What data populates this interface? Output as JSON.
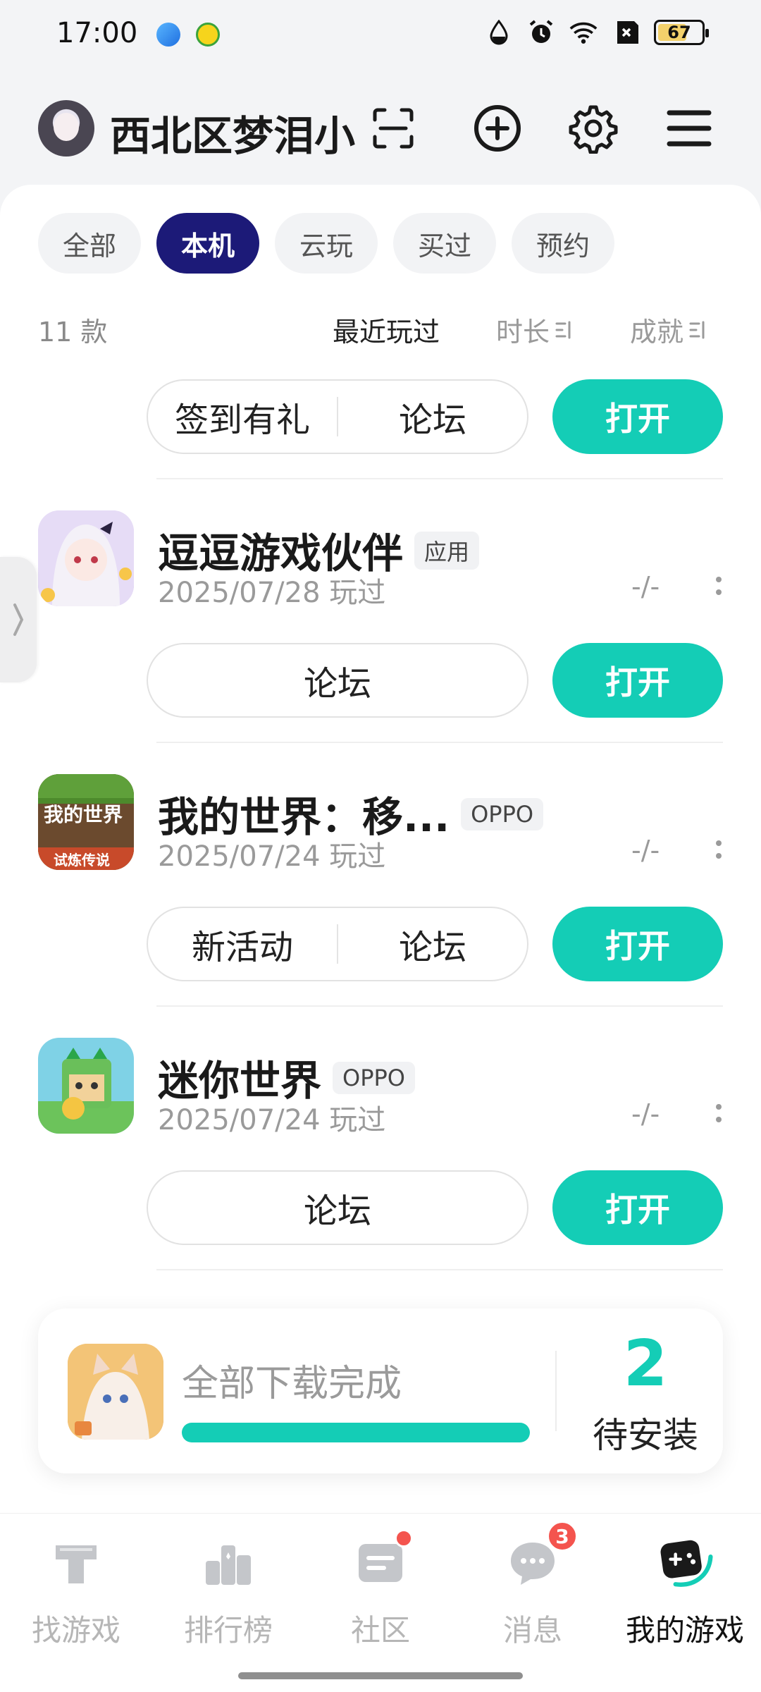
{
  "status_bar": {
    "time": "17:00",
    "battery": "67",
    "battery_level": 0.67,
    "icons": [
      "water-drop-icon",
      "alarm-icon",
      "wifi-icon",
      "no-sim-icon"
    ]
  },
  "header": {
    "username": "西北区梦泪小",
    "buttons": [
      "scan-icon",
      "add-icon",
      "settings-icon",
      "menu-icon"
    ]
  },
  "filter_tabs": [
    {
      "label": "全部",
      "active": false
    },
    {
      "label": "本机",
      "active": true
    },
    {
      "label": "云玩",
      "active": false
    },
    {
      "label": "买过",
      "active": false
    },
    {
      "label": "预约",
      "active": false
    }
  ],
  "sort_bar": {
    "count": "11 款",
    "recent": "最近玩过",
    "duration": "时长",
    "achievement": "成就"
  },
  "top_row": {
    "actions": [
      "签到有礼",
      "论坛"
    ],
    "open": "打开"
  },
  "games": [
    {
      "title": "逗逗游戏伙伴",
      "tag": "应用",
      "played": "2025/07/28 玩过",
      "duration": "-/-",
      "actions": [
        "论坛"
      ],
      "open": "打开"
    },
    {
      "title": "我的世界：移...",
      "tag": "OPPO",
      "played": "2025/07/24 玩过",
      "duration": "-/-",
      "actions": [
        "新活动",
        "论坛"
      ],
      "open": "打开",
      "icon_text": [
        "我的世界",
        "试炼传说"
      ]
    },
    {
      "title": "迷你世界",
      "tag": "OPPO",
      "played": "2025/07/24 玩过",
      "duration": "-/-",
      "actions": [
        "论坛"
      ],
      "open": "打开"
    }
  ],
  "download": {
    "status": "全部下载完成",
    "progress": 1.0,
    "count": "2",
    "count_label": "待安装"
  },
  "bottom_nav": [
    {
      "label": "找游戏",
      "icon": "find-games-icon",
      "active": false
    },
    {
      "label": "排行榜",
      "icon": "ranking-icon",
      "active": false
    },
    {
      "label": "社区",
      "icon": "community-icon",
      "active": false,
      "dot": true
    },
    {
      "label": "消息",
      "icon": "messages-icon",
      "active": false,
      "badge": "3"
    },
    {
      "label": "我的游戏",
      "icon": "my-games-icon",
      "active": true
    }
  ],
  "colors": {
    "accent": "#14cdb6",
    "tab_active": "#1c1a78",
    "badge": "#f4544e"
  }
}
